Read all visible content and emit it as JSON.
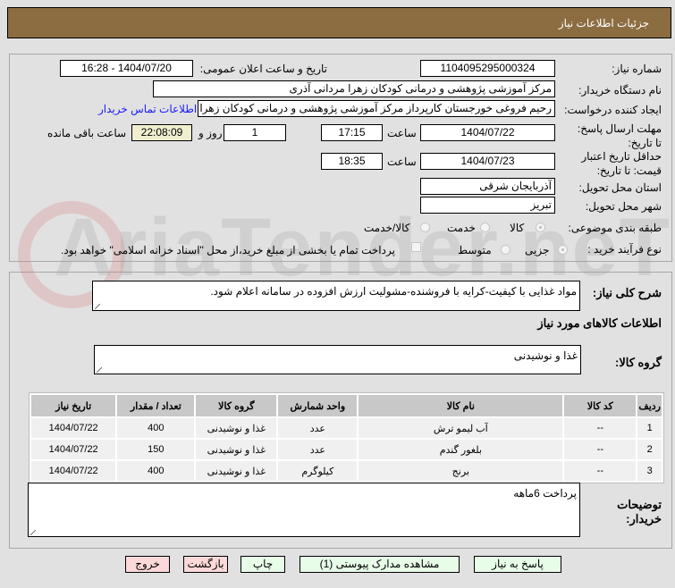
{
  "header": {
    "title": "جزئیات اطلاعات نیاز"
  },
  "watermark": "AriaTender.neT",
  "form": {
    "need_number_label": "شماره نیاز:",
    "need_number": "1104095295000324",
    "announce_label": "تاریخ و ساعت اعلان عمومی:",
    "announce_value": "1404/07/20 - 16:28",
    "buyer_org_label": "نام دستگاه خریدار:",
    "buyer_org": "مرکز آموزشی پژوهشی و درمانی کودکان زهرا مردانی آذری",
    "creator_label": "ایجاد کننده درخواست:",
    "creator": "رحیم فروغی خورجستان کارپرداز مرکز آموزشی پژوهشی و درمانی کودکان زهرا مردانی آذری",
    "contact_link": "اطلاعات تماس خریدار",
    "deadline_label": "مهلت ارسال پاسخ: تا تاریخ:",
    "deadline_date": "1404/07/22",
    "time_label": "ساعت",
    "deadline_time": "17:15",
    "days": "1",
    "days_label": "روز و",
    "remaining": "22:08:09",
    "remaining_label": "ساعت باقی مانده",
    "validity_label": "حداقل تاریخ اعتبار قیمت: تا تاریخ:",
    "validity_date": "1404/07/23",
    "validity_time": "18:35",
    "province_label": "استان محل تحویل:",
    "province": "آذربایجان شرقی",
    "city_label": "شهر محل تحویل:",
    "city": "تبریز",
    "category_label": "طبقه بندی موضوعی:",
    "category_options": [
      "کالا",
      "خدمت",
      "کالا/خدمت"
    ],
    "process_label": "نوع فرآیند خرید :",
    "process_options": [
      "جزیی",
      "متوسط"
    ],
    "payment_note": "پرداخت تمام یا بخشی از مبلغ خرید،از محل \"اسناد خزانه اسلامی\" خواهد بود."
  },
  "details": {
    "summary_label": "شرح کلی نیاز:",
    "summary": "مواد غذایی با کیفیت-کرایه با فروشنده-مشولیت ارزش افزوده در سامانه اعلام شود.",
    "goods_heading": "اطلاعات کالاهای مورد نیاز",
    "group_label": "گروه کالا:",
    "group": "غذا و نوشیدنی",
    "table": {
      "headers": [
        "ردیف",
        "کد کالا",
        "نام کالا",
        "واحد شمارش",
        "گروه کالا",
        "تعداد / مقدار",
        "تاریخ نیاز"
      ],
      "rows": [
        [
          "1",
          "--",
          "آب لیمو ترش",
          "عدد",
          "غذا و نوشیدنی",
          "400",
          "1404/07/22"
        ],
        [
          "2",
          "--",
          "بلغور گندم",
          "عدد",
          "غذا و نوشیدنی",
          "150",
          "1404/07/22"
        ],
        [
          "3",
          "--",
          "برنج",
          "کیلوگرم",
          "غذا و نوشیدنی",
          "400",
          "1404/07/22"
        ]
      ]
    },
    "notes_label": "توضیحات خریدار:",
    "notes": "پرداخت 6ماهه"
  },
  "buttons": {
    "reply": "پاسخ به نیاز",
    "attachments": "مشاهده مدارک پیوستی (1)",
    "print": "چاپ",
    "back": "بازگشت",
    "exit": "خروج"
  }
}
